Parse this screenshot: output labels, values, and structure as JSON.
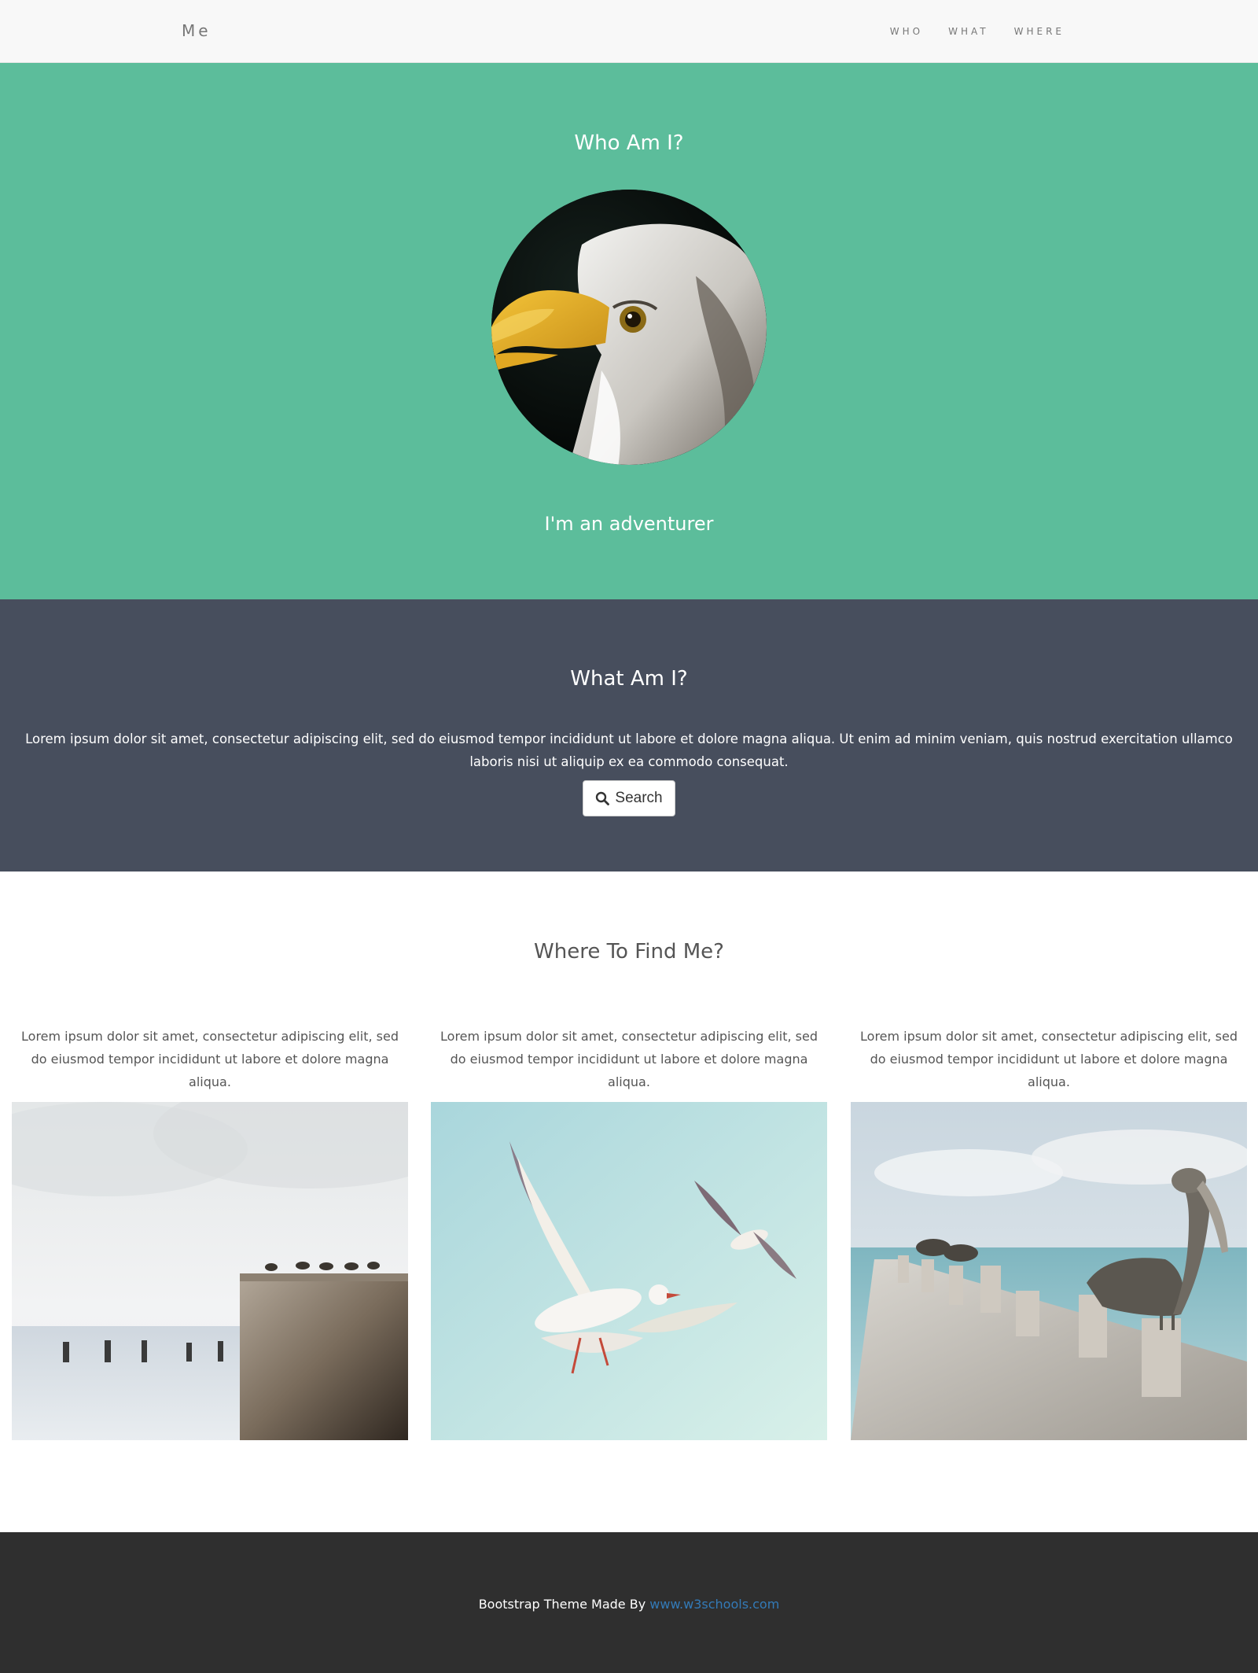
{
  "nav": {
    "brand": "Me",
    "links": [
      "WHO",
      "WHAT",
      "WHERE"
    ]
  },
  "who": {
    "title": "Who Am I?",
    "subtitle": "I'm an adventurer",
    "avatar_icon": "eagle-photo"
  },
  "what": {
    "title": "What Am I?",
    "text": "Lorem ipsum dolor sit amet, consectetur adipiscing elit, sed do eiusmod tempor incididunt ut labore et dolore magna aliqua. Ut enim ad minim veniam, quis nostrud exercitation ullamco laboris nisi ut aliquip ex ea commodo consequat.",
    "button_label": "Search",
    "button_icon": "search-icon"
  },
  "where": {
    "title": "Where To Find Me?",
    "columns": [
      {
        "text": "Lorem ipsum dolor sit amet, consectetur adipiscing elit, sed do eiusmod tempor incididunt ut labore et dolore magna aliqua.",
        "image": "birds-on-pier-photo"
      },
      {
        "text": "Lorem ipsum dolor sit amet, consectetur adipiscing elit, sed do eiusmod tempor incididunt ut labore et dolore magna aliqua.",
        "image": "seagulls-flying-photo"
      },
      {
        "text": "Lorem ipsum dolor sit amet, consectetur adipiscing elit, sed do eiusmod tempor incididunt ut labore et dolore magna aliqua.",
        "image": "pelican-dock-photo"
      }
    ]
  },
  "footer": {
    "text": "Bootstrap Theme Made By ",
    "link": "www.w3schools.com"
  },
  "colors": {
    "who_bg": "#5cbd9b",
    "what_bg": "#474e5d",
    "footer_bg": "#2f2f2f",
    "link": "#337ab7"
  }
}
